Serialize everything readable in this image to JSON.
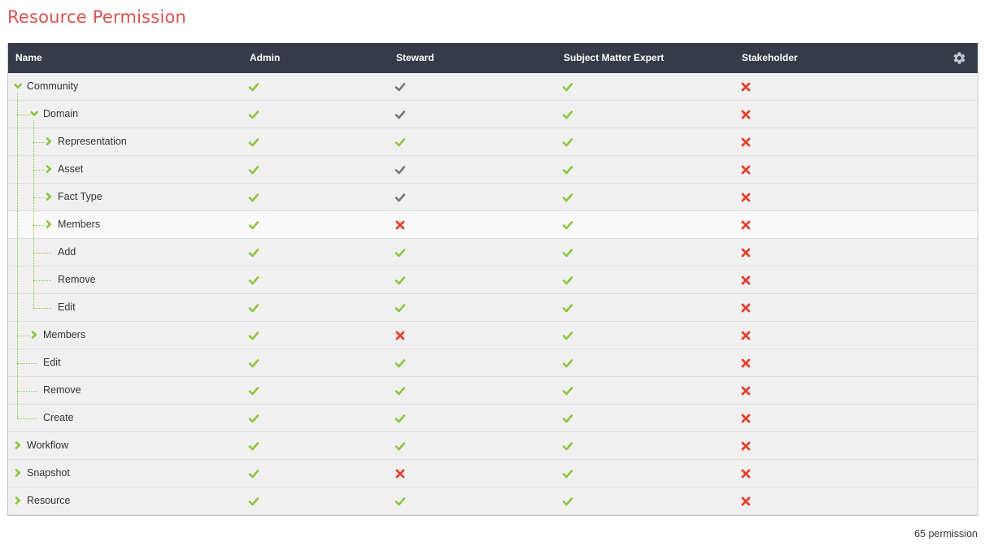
{
  "page": {
    "title": "Resource Permission",
    "footer": "65 permission"
  },
  "table": {
    "columns": [
      "Name",
      "Admin",
      "Steward",
      "Subject Matter Expert",
      "Stakeholder"
    ],
    "rows": [
      {
        "name": "Community",
        "level": 0,
        "toggle": "expanded",
        "values": [
          "check",
          "check-gray",
          "check",
          "cross"
        ]
      },
      {
        "name": "Domain",
        "level": 1,
        "toggle": "expanded",
        "values": [
          "check",
          "check-gray",
          "check",
          "cross"
        ]
      },
      {
        "name": "Representation",
        "level": 2,
        "toggle": "collapsed",
        "values": [
          "check",
          "check",
          "check",
          "cross"
        ]
      },
      {
        "name": "Asset",
        "level": 2,
        "toggle": "collapsed",
        "values": [
          "check",
          "check-gray",
          "check",
          "cross"
        ]
      },
      {
        "name": "Fact Type",
        "level": 2,
        "toggle": "collapsed",
        "values": [
          "check",
          "check-gray",
          "check",
          "cross"
        ]
      },
      {
        "name": "Members",
        "level": 2,
        "toggle": "collapsed",
        "values": [
          "check",
          "cross",
          "check",
          "cross"
        ],
        "highlight": true
      },
      {
        "name": "Add",
        "level": 2,
        "toggle": "none",
        "values": [
          "check",
          "check",
          "check",
          "cross"
        ]
      },
      {
        "name": "Remove",
        "level": 2,
        "toggle": "none",
        "values": [
          "check",
          "check",
          "check",
          "cross"
        ]
      },
      {
        "name": "Edit",
        "level": 2,
        "toggle": "none",
        "values": [
          "check",
          "check",
          "check",
          "cross"
        ]
      },
      {
        "name": "Members",
        "level": 1,
        "toggle": "collapsed",
        "values": [
          "check",
          "cross",
          "check",
          "cross"
        ]
      },
      {
        "name": "Edit",
        "level": 1,
        "toggle": "none",
        "values": [
          "check",
          "check",
          "check",
          "cross"
        ]
      },
      {
        "name": "Remove",
        "level": 1,
        "toggle": "none",
        "values": [
          "check",
          "check",
          "check",
          "cross"
        ]
      },
      {
        "name": "Create",
        "level": 1,
        "toggle": "none",
        "values": [
          "check",
          "check",
          "check",
          "cross"
        ]
      },
      {
        "name": "Workflow",
        "level": 0,
        "toggle": "collapsed",
        "values": [
          "check",
          "check",
          "check",
          "cross"
        ]
      },
      {
        "name": "Snapshot",
        "level": 0,
        "toggle": "collapsed",
        "values": [
          "check",
          "cross",
          "check",
          "cross"
        ]
      },
      {
        "name": "Resource",
        "level": 0,
        "toggle": "collapsed",
        "values": [
          "check",
          "check",
          "check",
          "cross"
        ]
      }
    ]
  },
  "icons": {
    "header_settings": "gear-icon",
    "granted": "check-icon",
    "inherited": "check-gray-icon",
    "denied": "cross-icon",
    "expanded": "chevron-down-icon",
    "collapsed": "chevron-right-icon"
  },
  "colors": {
    "title": "#d9534f",
    "header_bg": "#353c48",
    "check": "#8dc63f",
    "check_gray": "#777777",
    "cross": "#e2412f",
    "row_bg": "#f0f0f0",
    "row_highlight": "#f9f9f9",
    "tree_line": "#8dc63f"
  }
}
